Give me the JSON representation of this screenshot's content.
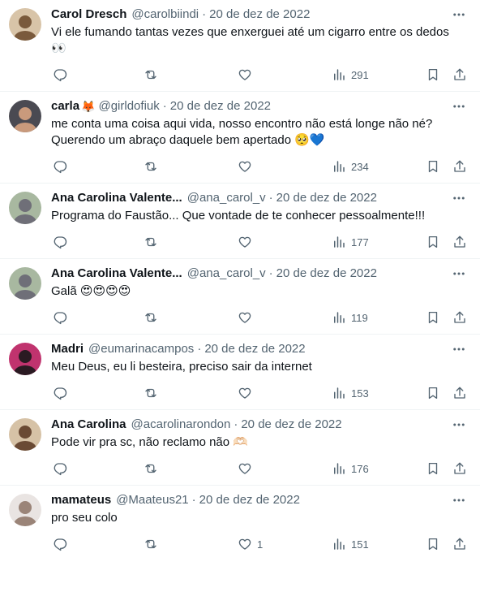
{
  "tweets": [
    {
      "name": "Carol Dresch",
      "name_emoji": "",
      "handle": "@carolbiindi",
      "date": "20 de dez de 2022",
      "text": "Vi ele fumando tantas vezes que enxerguei até um cigarro entre os dedos 👀",
      "likes": "",
      "views": "291",
      "avatar_colors": [
        "#d8c4a8",
        "#7a5a3c"
      ]
    },
    {
      "name": "carla",
      "name_emoji": "🦊",
      "handle": "@girldofiuk",
      "date": "20 de dez de 2022",
      "text": "me conta uma coisa aqui vida, nosso encontro não está longe não né?\nQuerendo um abraço daquele bem apertado 🥺💙",
      "likes": "",
      "views": "234",
      "avatar_colors": [
        "#4a4a52",
        "#c99a7c"
      ]
    },
    {
      "name": "Ana Carolina Valente...",
      "name_emoji": "",
      "handle": "@ana_carol_v",
      "date": "20 de dez de 2022",
      "text": "Programa do Faustão... Que vontade de te conhecer pessoalmente!!!",
      "likes": "",
      "views": "177",
      "avatar_colors": [
        "#a8b8a0",
        "#6f6f78"
      ]
    },
    {
      "name": "Ana Carolina Valente...",
      "name_emoji": "",
      "handle": "@ana_carol_v",
      "date": "20 de dez de 2022",
      "text": "Galã 😍😍😍😍",
      "likes": "",
      "views": "119",
      "avatar_colors": [
        "#a8b8a0",
        "#6f6f78"
      ]
    },
    {
      "name": "Madri",
      "name_emoji": "",
      "handle": "@eumarinacampos",
      "date": "20 de dez de 2022",
      "text": "Meu Deus, eu li besteira, preciso sair da internet",
      "likes": "",
      "views": "153",
      "avatar_colors": [
        "#c0336e",
        "#2a1a22"
      ]
    },
    {
      "name": "Ana Carolina",
      "name_emoji": "",
      "handle": "@acarolinarondon",
      "date": "20 de dez de 2022",
      "text": "Pode vir pra sc, não reclamo não 🫶🏻",
      "likes": "",
      "views": "176",
      "avatar_colors": [
        "#d6c2a6",
        "#6a4a34"
      ]
    },
    {
      "name": "mamateus",
      "name_emoji": "",
      "handle": "@Maateus21",
      "date": "20 de dez de 2022",
      "text": "pro seu colo",
      "likes": "1",
      "views": "151",
      "avatar_colors": [
        "#e9e4e2",
        "#9a8478"
      ]
    }
  ],
  "icons": {
    "more": "more-icon",
    "reply": "reply-icon",
    "retweet": "retweet-icon",
    "like": "heart-icon",
    "views": "views-icon",
    "bookmark": "bookmark-icon",
    "share": "share-icon"
  }
}
